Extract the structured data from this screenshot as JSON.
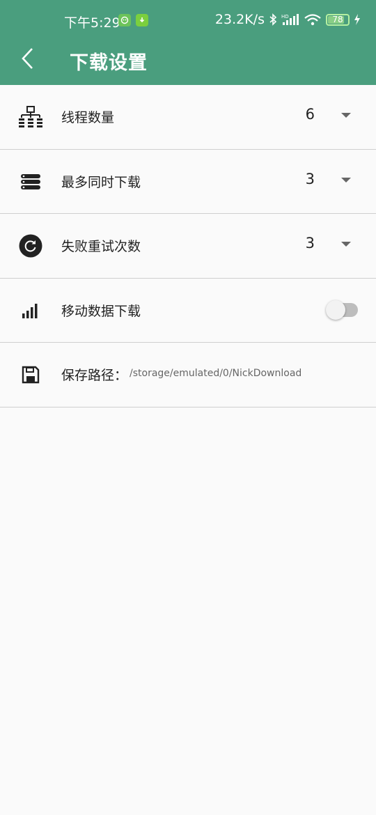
{
  "status_bar": {
    "time": "下午5:29",
    "net_speed": "23.2K/s",
    "battery": "78"
  },
  "toolbar": {
    "title": "下载设置"
  },
  "settings": [
    {
      "label": "线程数量",
      "value": "6",
      "icon": "network-tree-icon"
    },
    {
      "label": "最多同时下载",
      "value": "3",
      "icon": "server-stack-icon"
    },
    {
      "label": "失败重试次数",
      "value": "3",
      "icon": "retry-circle-icon"
    },
    {
      "label": "移动数据下载",
      "toggle": false,
      "icon": "signal-bars-icon"
    },
    {
      "label": "保存路径：",
      "path": "/storage/emulated/0/NickDownload",
      "icon": "floppy-disk-icon"
    }
  ],
  "colors": {
    "header": "#4a9e7e",
    "background": "#fafafa",
    "divider": "#cfcfcf"
  }
}
